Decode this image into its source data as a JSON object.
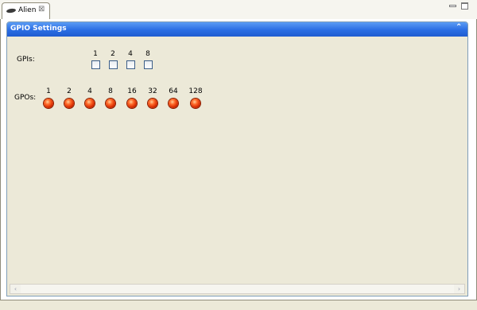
{
  "tab": {
    "label": "Alien",
    "close": "⊠"
  },
  "window": {
    "minimize": "",
    "maximize": ""
  },
  "section": {
    "title": "GPIO Settings",
    "collapse_glyph": "⌃"
  },
  "gpi": {
    "label": "GPIs:",
    "bits": [
      {
        "value": "1",
        "checked": false
      },
      {
        "value": "2",
        "checked": false
      },
      {
        "value": "4",
        "checked": false
      },
      {
        "value": "8",
        "checked": false
      }
    ]
  },
  "gpo": {
    "label": "GPOs:",
    "bits": [
      {
        "value": "1",
        "state": "on"
      },
      {
        "value": "2",
        "state": "on"
      },
      {
        "value": "4",
        "state": "on"
      },
      {
        "value": "8",
        "state": "on"
      },
      {
        "value": "16",
        "state": "on"
      },
      {
        "value": "32",
        "state": "on"
      },
      {
        "value": "64",
        "state": "on"
      },
      {
        "value": "128",
        "state": "on"
      }
    ]
  },
  "scrollbar": {
    "left_arrow": "‹",
    "right_arrow": "›"
  },
  "colors": {
    "header_blue": "#2a6de3",
    "led_red": "#d62a00",
    "panel_bg": "#ece9d8"
  }
}
